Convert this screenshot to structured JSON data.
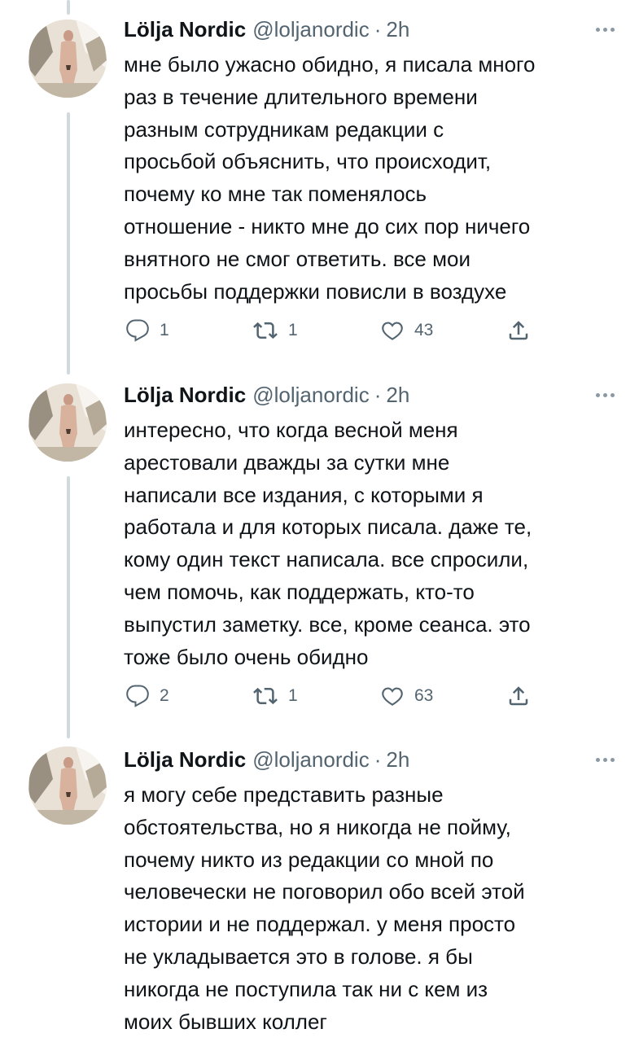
{
  "tweets": [
    {
      "name": "Lölja Nordic",
      "handle": "@loljanordic",
      "separator": "·",
      "time": "2h",
      "text": "мне было ужасно обидно, я писала много\nраз в течение длительного времени\nразным сотрудникам редакции с\nпросьбой объяснить, что происходит,\nпочему ко мне так поменялось\nотношение - никто мне до сих пор ничего\nвнятного не смог ответить. все мои\nпросьбы поддержки повисли в воздухе",
      "replies": "1",
      "retweets": "1",
      "likes": "43"
    },
    {
      "name": "Lölja Nordic",
      "handle": "@loljanordic",
      "separator": "·",
      "time": "2h",
      "text": "интересно, что когда весной меня\nарестовали дважды за сутки мне\nнаписали все издания, с которыми я\nработала и для которых писала. даже те,\nкому один текст написала. все спросили,\nчем помочь, как поддержать, кто-то\nвыпустил заметку. все, кроме сеанса. это\nтоже было очень обидно",
      "replies": "2",
      "retweets": "1",
      "likes": "63"
    },
    {
      "name": "Lölja Nordic",
      "handle": "@loljanordic",
      "separator": "·",
      "time": "2h",
      "text": "я могу себе представить разные\nобстоятельства, но я никогда не пойму,\nпочему никто из редакции со мной по\nчеловечески не поговорил обо всей этой\nистории и не поддержал. у меня просто\nне укладывается это в голове. я бы\nникогда не поступила так ни с кем из\nмоих бывших коллег",
      "replies": "",
      "retweets": "",
      "likes": ""
    }
  ],
  "icons": {
    "reply": "reply-icon",
    "retweet": "retweet-icon",
    "like": "heart-icon",
    "share": "share-icon",
    "more": "more-icon"
  },
  "colors": {
    "text": "#0f1419",
    "secondary": "#536471",
    "thread_line": "#cfd9de",
    "background": "#ffffff"
  }
}
